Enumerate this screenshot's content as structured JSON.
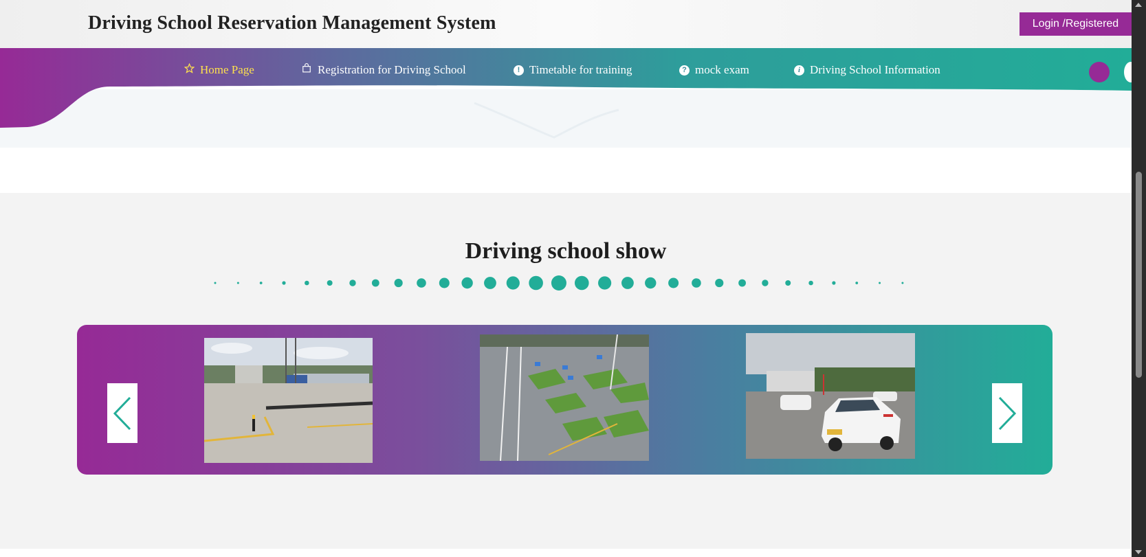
{
  "header": {
    "title": "Driving School Reservation Management System",
    "login_label": "Login /Registered"
  },
  "nav": {
    "items": [
      {
        "label": "Home Page",
        "icon": "star-icon",
        "active": true
      },
      {
        "label": "Registration for Driving School",
        "icon": "bag-icon",
        "active": false
      },
      {
        "label": "Timetable for training",
        "icon": "exclamation-icon",
        "active": false
      },
      {
        "label": "mock exam",
        "icon": "question-icon",
        "active": false
      },
      {
        "label": "Driving School Information",
        "icon": "info-icon",
        "active": false
      }
    ]
  },
  "show": {
    "title": "Driving school show",
    "photos": [
      {
        "subject": "training-yard-photo"
      },
      {
        "subject": "aerial-course-photo"
      },
      {
        "subject": "training-car-photo"
      }
    ]
  },
  "colors": {
    "purple": "#962a96",
    "teal": "#22ad98",
    "active_nav": "#ffe14d",
    "section_bg": "#f3f3f3"
  }
}
